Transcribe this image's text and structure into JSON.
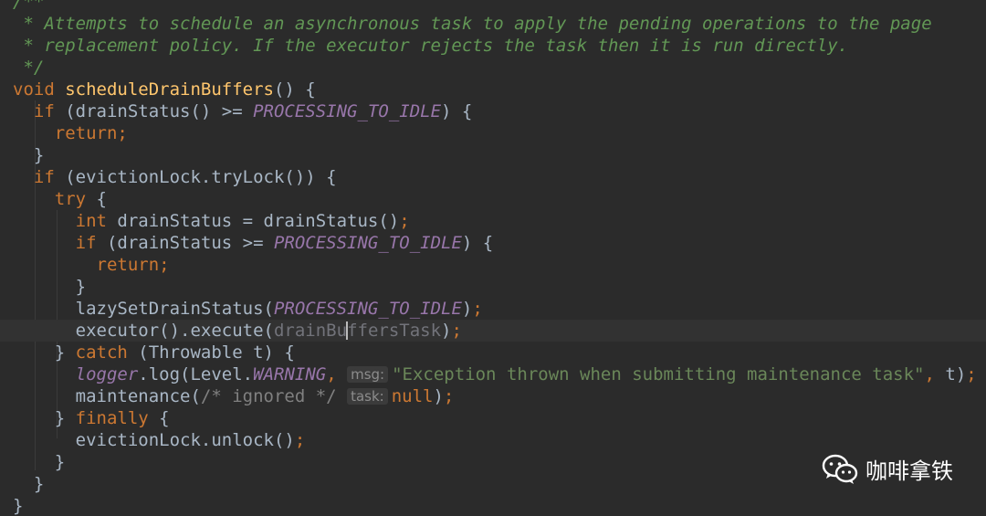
{
  "editor": {
    "lines": [
      {
        "segments": [
          {
            "cls": "doc",
            "text": "/**"
          }
        ]
      },
      {
        "segments": [
          {
            "cls": "doc",
            "text": " * Attempts to schedule an asynchronous task to apply the pending operations to the page"
          }
        ]
      },
      {
        "segments": [
          {
            "cls": "doc",
            "text": " * replacement policy. If the executor rejects the task then it is run directly."
          }
        ]
      },
      {
        "segments": [
          {
            "cls": "doc",
            "text": " */"
          }
        ]
      },
      {
        "segments": [
          {
            "cls": "kw",
            "text": "void "
          },
          {
            "cls": "method",
            "text": "scheduleDrainBuffers"
          },
          {
            "cls": "",
            "text": "() {"
          }
        ]
      },
      {
        "segments": [
          {
            "cls": "kw",
            "text": "  if "
          },
          {
            "cls": "",
            "text": "(drainStatus() >= "
          },
          {
            "cls": "const",
            "text": "PROCESSING_TO_IDLE"
          },
          {
            "cls": "",
            "text": ") {"
          }
        ]
      },
      {
        "segments": [
          {
            "cls": "kw",
            "text": "    return;"
          }
        ]
      },
      {
        "segments": [
          {
            "cls": "",
            "text": "  }"
          }
        ]
      },
      {
        "segments": [
          {
            "cls": "kw",
            "text": "  if "
          },
          {
            "cls": "",
            "text": "(evictionLock.tryLock()) {"
          }
        ]
      },
      {
        "segments": [
          {
            "cls": "kw",
            "text": "    try "
          },
          {
            "cls": "",
            "text": "{"
          }
        ]
      },
      {
        "segments": [
          {
            "cls": "kw",
            "text": "      int "
          },
          {
            "cls": "",
            "text": "drainStatus = drainStatus()"
          },
          {
            "cls": "kw",
            "text": ";"
          }
        ]
      },
      {
        "segments": [
          {
            "cls": "kw",
            "text": "      if "
          },
          {
            "cls": "",
            "text": "(drainStatus >= "
          },
          {
            "cls": "const",
            "text": "PROCESSING_TO_IDLE"
          },
          {
            "cls": "",
            "text": ") {"
          }
        ]
      },
      {
        "segments": [
          {
            "cls": "kw",
            "text": "        return;"
          }
        ]
      },
      {
        "segments": [
          {
            "cls": "",
            "text": "      }"
          }
        ]
      },
      {
        "segments": [
          {
            "cls": "",
            "text": "      lazySetDrainStatus("
          },
          {
            "cls": "const",
            "text": "PROCESSING_TO_IDLE"
          },
          {
            "cls": "",
            "text": ")"
          },
          {
            "cls": "kw",
            "text": ";"
          }
        ]
      },
      {
        "current": true,
        "segments": [
          {
            "cls": "",
            "text": "      executor().execute("
          },
          {
            "cls": "unused",
            "text": "drainBu"
          },
          {
            "cls": "caret",
            "text": ""
          },
          {
            "cls": "unused",
            "text": "ffersTask"
          },
          {
            "cls": "",
            "text": ")"
          },
          {
            "cls": "kw",
            "text": ";"
          }
        ]
      },
      {
        "segments": [
          {
            "cls": "",
            "text": "    } "
          },
          {
            "cls": "kw",
            "text": "catch "
          },
          {
            "cls": "",
            "text": "(Throwable t) {"
          }
        ]
      },
      {
        "segments": [
          {
            "cls": "field-static",
            "text": "      logger"
          },
          {
            "cls": "",
            "text": ".log(Level."
          },
          {
            "cls": "const",
            "text": "WARNING"
          },
          {
            "cls": "kw",
            "text": ", "
          },
          {
            "cls": "hint",
            "text": "msg:"
          },
          {
            "cls": "str",
            "text": "\"Exception thrown when submitting maintenance task\""
          },
          {
            "cls": "kw",
            "text": ", "
          },
          {
            "cls": "",
            "text": "t)"
          },
          {
            "cls": "kw",
            "text": ";"
          }
        ]
      },
      {
        "segments": [
          {
            "cls": "",
            "text": "      maintenance("
          },
          {
            "cls": "comment",
            "text": "/* ignored */ "
          },
          {
            "cls": "hint",
            "text": "task:"
          },
          {
            "cls": "kw",
            "text": "null"
          },
          {
            "cls": "",
            "text": ")"
          },
          {
            "cls": "kw",
            "text": ";"
          }
        ]
      },
      {
        "segments": [
          {
            "cls": "",
            "text": "    } "
          },
          {
            "cls": "kw",
            "text": "finally "
          },
          {
            "cls": "",
            "text": "{"
          }
        ]
      },
      {
        "segments": [
          {
            "cls": "",
            "text": "      evictionLock.unlock()"
          },
          {
            "cls": "kw",
            "text": ";"
          }
        ]
      },
      {
        "segments": [
          {
            "cls": "",
            "text": "    }"
          }
        ]
      },
      {
        "segments": [
          {
            "cls": "",
            "text": "  }"
          }
        ]
      },
      {
        "segments": [
          {
            "cls": "",
            "text": "}"
          }
        ]
      }
    ]
  },
  "watermark": {
    "icon": "wechat-icon",
    "text": "咖啡拿铁"
  }
}
